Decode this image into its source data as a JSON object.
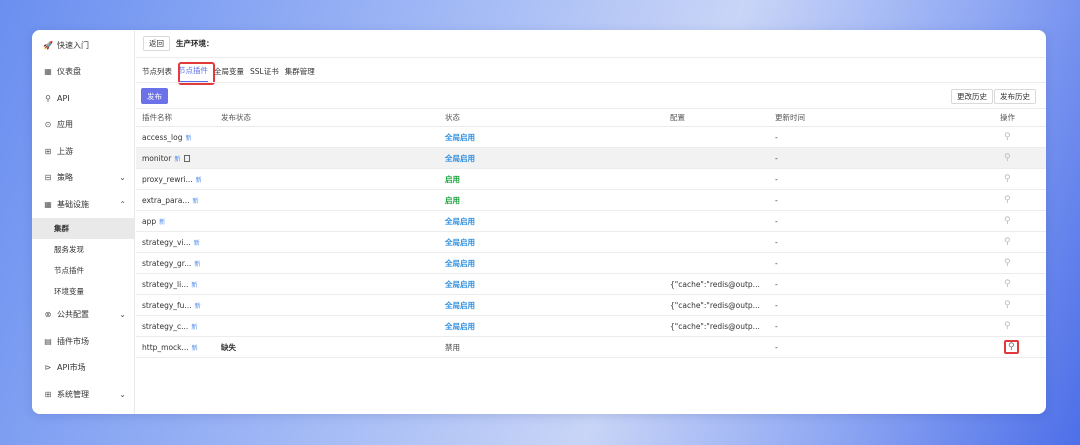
{
  "sidebar": {
    "items": [
      {
        "icon": "🚀",
        "label": "快速入门"
      },
      {
        "icon": "▦",
        "label": "仪表盘"
      },
      {
        "icon": "⚲",
        "label": "API"
      },
      {
        "icon": "⊙",
        "label": "应用"
      },
      {
        "icon": "⊞",
        "label": "上游"
      },
      {
        "icon": "⊟",
        "label": "策略",
        "chev": "⌄"
      },
      {
        "icon": "▦",
        "label": "基础设施",
        "chev": "⌃"
      }
    ],
    "sub_items": [
      "集群",
      "服务发现",
      "节点插件",
      "环境变量"
    ],
    "bottom_items": [
      {
        "icon": "⊗",
        "label": "公共配置",
        "chev": "⌄"
      },
      {
        "icon": "▤",
        "label": "插件市场"
      },
      {
        "icon": "⊳",
        "label": "API市场"
      },
      {
        "icon": "⊞",
        "label": "系统管理",
        "chev": "⌄"
      }
    ]
  },
  "topbar": {
    "back_label": "返回",
    "env_label": "生产环境："
  },
  "tabs": [
    "节点列表",
    "节点插件",
    "全局变量",
    "SSL证书",
    "集群管理"
  ],
  "toolbar": {
    "publish_label": "发布",
    "change_history_label": "更改历史",
    "publish_history_label": "发布历史"
  },
  "table": {
    "headers": [
      "插件名称",
      "发布状态",
      "状态",
      "配置",
      "更新时间",
      "操作"
    ],
    "rows": [
      {
        "name": "access_log",
        "tag": "新",
        "pub": "",
        "status": "全局启用",
        "config": "",
        "time": "-"
      },
      {
        "name": "monitor",
        "tag": "新",
        "pub": "",
        "status": "全局启用",
        "config": "",
        "time": "-"
      },
      {
        "name": "proxy_rewri...",
        "tag": "新",
        "pub": "",
        "status": "启用",
        "config": "",
        "time": "-"
      },
      {
        "name": "extra_para...",
        "tag": "新",
        "pub": "",
        "status": "启用",
        "config": "",
        "time": "-"
      },
      {
        "name": "app",
        "tag": "新",
        "pub": "",
        "status": "全局启用",
        "config": "",
        "time": "-"
      },
      {
        "name": "strategy_vi...",
        "tag": "新",
        "pub": "",
        "status": "全局启用",
        "config": "",
        "time": "-"
      },
      {
        "name": "strategy_gr...",
        "tag": "新",
        "pub": "",
        "status": "全局启用",
        "config": "",
        "time": "-"
      },
      {
        "name": "strategy_li...",
        "tag": "新",
        "pub": "",
        "status": "全局启用",
        "config": "{\"cache\":\"redis@outp...",
        "time": "-"
      },
      {
        "name": "strategy_fu...",
        "tag": "新",
        "pub": "",
        "status": "全局启用",
        "config": "{\"cache\":\"redis@outp...",
        "time": "-"
      },
      {
        "name": "strategy_c...",
        "tag": "新",
        "pub": "",
        "status": "全局启用",
        "config": "{\"cache\":\"redis@outp...",
        "time": "-"
      },
      {
        "name": "http_mock...",
        "tag": "新",
        "pub": "缺失",
        "status": "禁用",
        "config": "",
        "time": "-"
      }
    ],
    "wrench_icon": "⚲"
  },
  "colors": {
    "accent": "#6b71e8",
    "global_enabled": "#2f8fe0",
    "enabled": "#1aa33c",
    "highlight": "#e2393c"
  }
}
